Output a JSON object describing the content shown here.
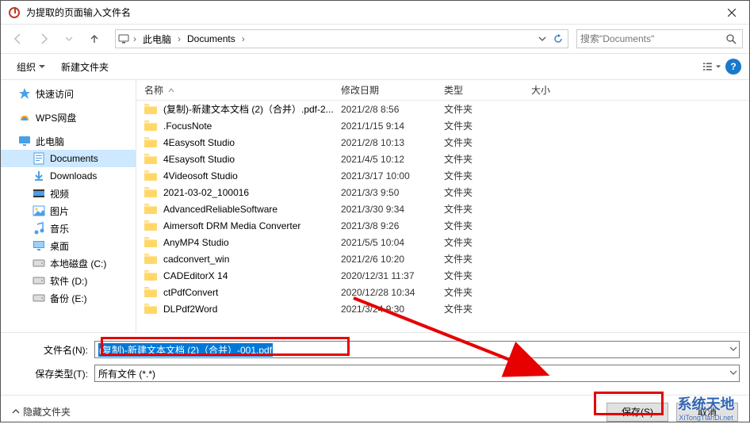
{
  "window": {
    "title": "为提取的页面输入文件名"
  },
  "breadcrumbs": {
    "root_icon": "pc",
    "items": [
      "此电脑",
      "Documents"
    ],
    "sep": "›"
  },
  "search": {
    "placeholder": "搜索\"Documents\""
  },
  "toolbar": {
    "organize": "组织",
    "new_folder": "新建文件夹"
  },
  "columns": {
    "name": "名称",
    "date": "修改日期",
    "type": "类型",
    "size": "大小"
  },
  "sidebar": [
    {
      "icon": "star",
      "color": "#49a0e8",
      "label": "快速访问",
      "indent": false
    },
    {
      "spacer": true
    },
    {
      "icon": "wps",
      "color": "#ff9a1f",
      "label": "WPS网盘",
      "indent": false
    },
    {
      "spacer": true
    },
    {
      "icon": "pc",
      "color": "#4aa0e8",
      "label": "此电脑",
      "indent": false
    },
    {
      "icon": "doc",
      "color": "#4aa0e8",
      "label": "Documents",
      "indent": true,
      "active": true
    },
    {
      "icon": "dl",
      "color": "#4aa0e8",
      "label": "Downloads",
      "indent": true
    },
    {
      "icon": "video",
      "color": "#4aa0e8",
      "label": "视频",
      "indent": true
    },
    {
      "icon": "pic",
      "color": "#4aa0e8",
      "label": "图片",
      "indent": true
    },
    {
      "icon": "music",
      "color": "#4aa0e8",
      "label": "音乐",
      "indent": true
    },
    {
      "icon": "desk",
      "color": "#4aa0e8",
      "label": "桌面",
      "indent": true
    },
    {
      "icon": "disk",
      "color": "#888",
      "label": "本地磁盘 (C:)",
      "indent": true
    },
    {
      "icon": "disk",
      "color": "#888",
      "label": "软件 (D:)",
      "indent": true
    },
    {
      "icon": "disk",
      "color": "#888",
      "label": "备份 (E:)",
      "indent": true
    }
  ],
  "files": [
    {
      "name": "(复制)-新建文本文档 (2)（合并）.pdf-2...",
      "date": "2021/2/8 8:56",
      "type": "文件夹"
    },
    {
      "name": ".FocusNote",
      "date": "2021/1/15 9:14",
      "type": "文件夹"
    },
    {
      "name": "4Easysoft Studio",
      "date": "2021/2/8 10:13",
      "type": "文件夹"
    },
    {
      "name": "4Esaysoft Studio",
      "date": "2021/4/5 10:12",
      "type": "文件夹"
    },
    {
      "name": "4Videosoft Studio",
      "date": "2021/3/17 10:00",
      "type": "文件夹"
    },
    {
      "name": "2021-03-02_100016",
      "date": "2021/3/3 9:50",
      "type": "文件夹"
    },
    {
      "name": "AdvancedReliableSoftware",
      "date": "2021/3/30 9:34",
      "type": "文件夹"
    },
    {
      "name": "Aimersoft DRM Media Converter",
      "date": "2021/3/8 9:26",
      "type": "文件夹"
    },
    {
      "name": "AnyMP4 Studio",
      "date": "2021/5/5 10:04",
      "type": "文件夹"
    },
    {
      "name": "cadconvert_win",
      "date": "2021/2/6 10:20",
      "type": "文件夹"
    },
    {
      "name": "CADEditorX 14",
      "date": "2020/12/31 11:37",
      "type": "文件夹"
    },
    {
      "name": "ctPdfConvert",
      "date": "2020/12/28 10:34",
      "type": "文件夹"
    },
    {
      "name": "DLPdf2Word",
      "date": "2021/3/24 9:30",
      "type": "文件夹"
    }
  ],
  "form": {
    "filename_label": "文件名(N):",
    "filename_value": "(复制)-新建文本文档 (2)（合并）-001.pdf",
    "filetype_label": "保存类型(T):",
    "filetype_value": "所有文件 (*.*)"
  },
  "actions": {
    "hide_folders": "隐藏文件夹",
    "save": "保存(S)",
    "cancel": "取消"
  },
  "watermark": {
    "line1": "系统天地",
    "line2": "XiTongTianDi.net"
  }
}
